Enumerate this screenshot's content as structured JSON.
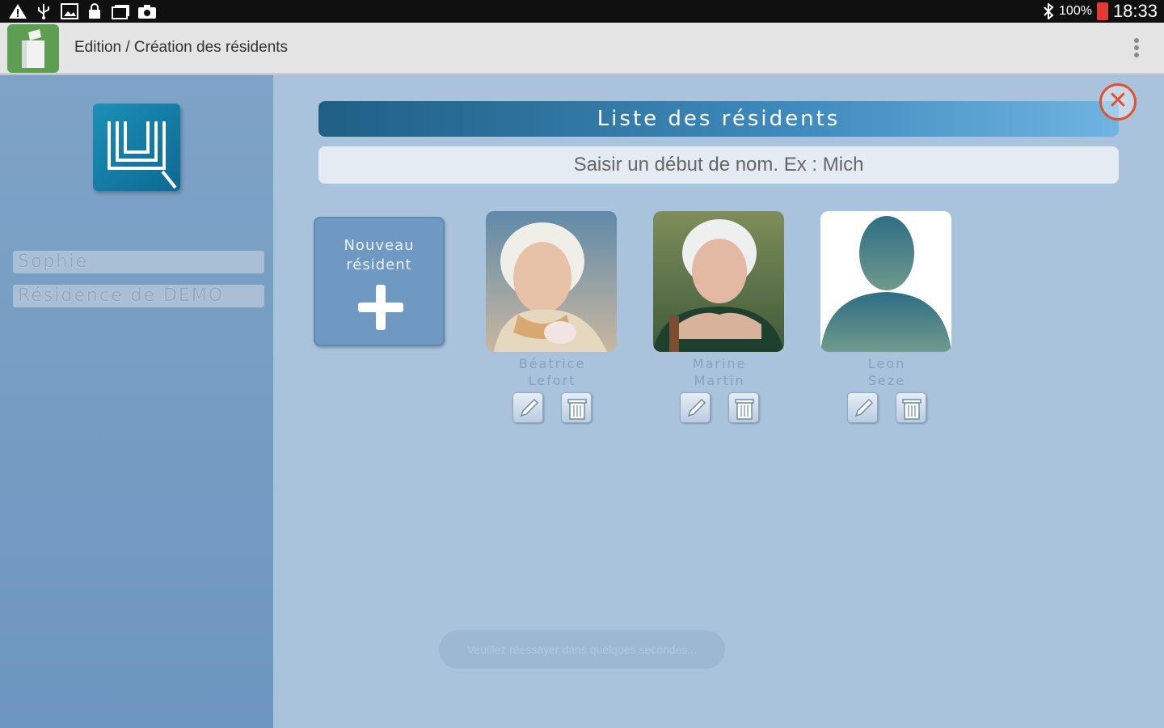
{
  "status_bar": {
    "battery_percent": "100%",
    "time": "18:33",
    "left_icons": [
      "warning-icon",
      "usb-icon",
      "image-icon",
      "lock-icon",
      "photo-stack-icon",
      "camera-icon"
    ],
    "right_icons": [
      "bluetooth-icon",
      "battery-icon"
    ]
  },
  "action_bar": {
    "title": "Edition / Création des résidents",
    "app_icon": "app-icon",
    "menu_icon": "overflow-menu-icon"
  },
  "sidebar": {
    "logo_icon": "app-logo-icon",
    "user_name": "Sophie",
    "residence": "Résidence de DEMO"
  },
  "main": {
    "list_title": "Liste des résidents",
    "search_placeholder": "Saisir un début de nom. Ex : Mich",
    "close_icon": "close-icon",
    "new_resident_label": "Nouveau résident",
    "residents": [
      {
        "first_name": "Béatrice",
        "last_name": "Lefort",
        "photo": "portrait-photo"
      },
      {
        "first_name": "Marine",
        "last_name": "Martin",
        "photo": "portrait-photo"
      },
      {
        "first_name": "Leon",
        "last_name": "Seze",
        "photo": "default-avatar-icon"
      }
    ],
    "edit_icon": "pencil-icon",
    "delete_icon": "trash-icon"
  },
  "toast": {
    "message": "Veuillez réessayer dans quelques secondes..."
  },
  "colors": {
    "title_gradient_start": "#1f5f85",
    "title_gradient_end": "#6fb4e2",
    "close_accent": "#e0512f",
    "sidebar_bg": "#7ea3c6",
    "main_bg": "#a9c3dc"
  }
}
